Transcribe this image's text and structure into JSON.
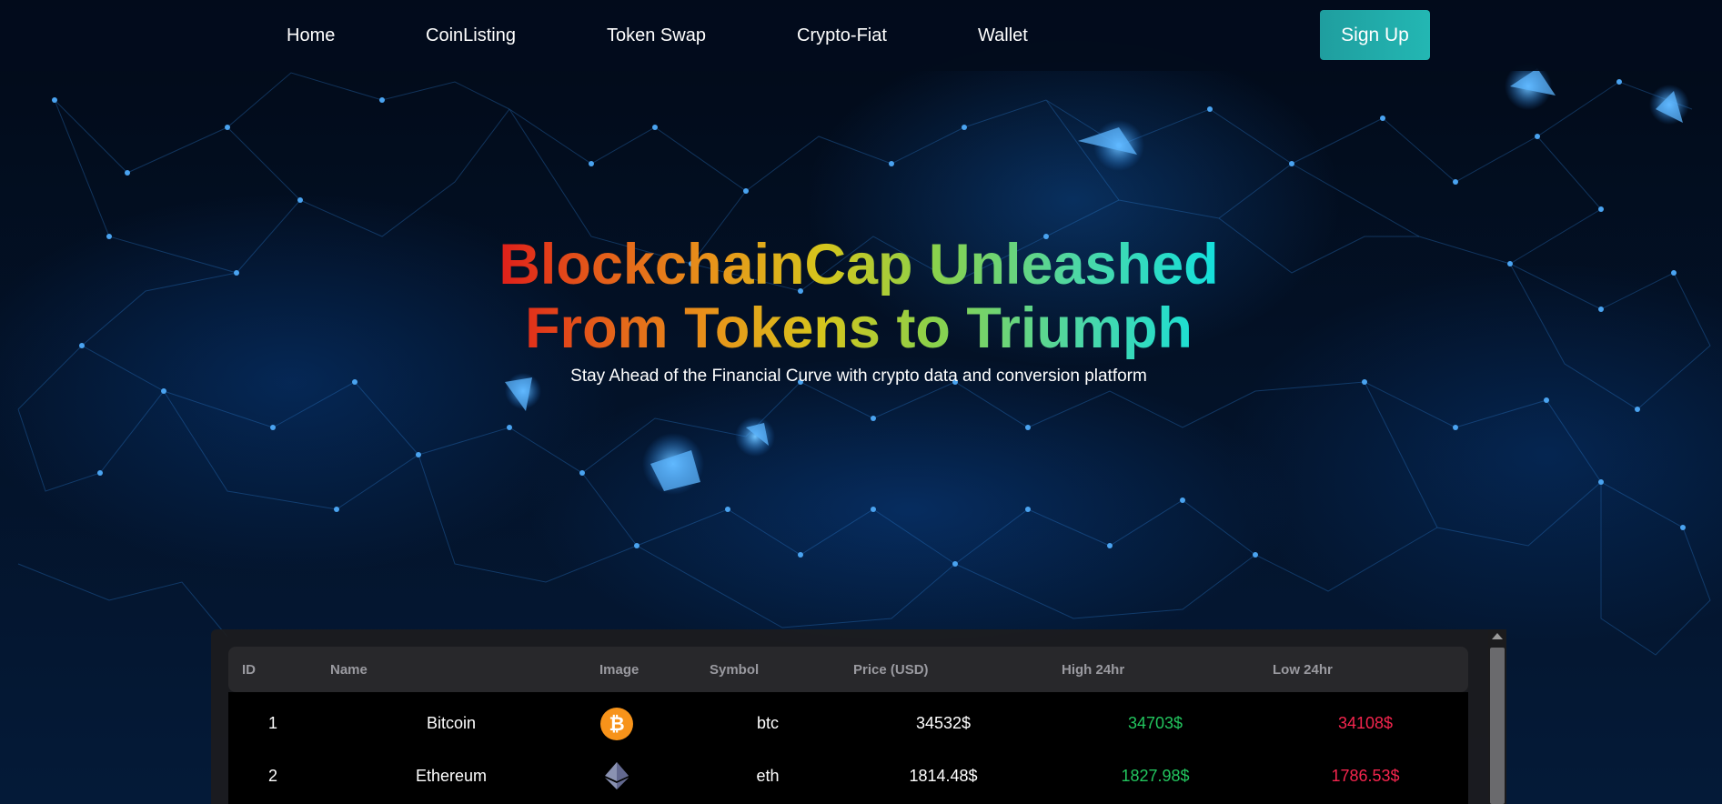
{
  "nav": {
    "links": [
      "Home",
      "CoinListing",
      "Token Swap",
      "Crypto-Fiat",
      "Wallet"
    ],
    "signup_label": "Sign Up"
  },
  "hero": {
    "title_line1": "BlockchainCap Unleashed",
    "title_line2": "From Tokens to Triumph",
    "subtitle": "Stay Ahead of the Financial Curve with crypto data and conversion platform"
  },
  "table": {
    "headers": [
      "ID",
      "Name",
      "Image",
      "Symbol",
      "Price (USD)",
      "High 24hr",
      "Low 24hr"
    ],
    "rows": [
      {
        "id": "1",
        "name": "Bitcoin",
        "image": "bitcoin-icon",
        "symbol": "btc",
        "price": "34532$",
        "high": "34703$",
        "low": "34108$"
      },
      {
        "id": "2",
        "name": "Ethereum",
        "image": "ethereum-icon",
        "symbol": "eth",
        "price": "1814.48$",
        "high": "1827.98$",
        "low": "1786.53$"
      }
    ]
  },
  "colors": {
    "accent": "#23b7b3",
    "high": "#22c55e",
    "low": "#f5254e",
    "bitcoin": "#f7931a"
  }
}
